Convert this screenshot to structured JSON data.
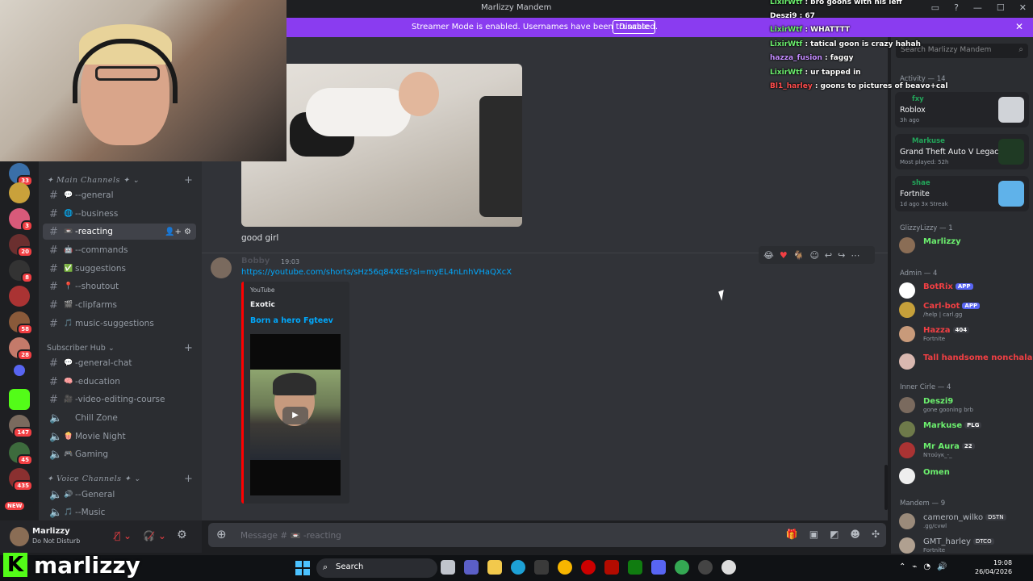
{
  "window": {
    "title": "Marlizzy Mandem"
  },
  "banner": {
    "text": "Streamer Mode is enabled. Usernames have been truncated.",
    "button": "Disable"
  },
  "rail": {
    "badges": [
      "33",
      "3",
      "20",
      "8",
      "58",
      "28",
      "147",
      "45",
      "435",
      "NEW"
    ]
  },
  "sidebar": {
    "main_category": "✦ Main Channels ✦",
    "subscriber_category": "Subscriber Hub",
    "voice_category": "✦ Voice Channels ✦",
    "channels": [
      {
        "label": "--general",
        "emoji": "💬"
      },
      {
        "label": "--business",
        "emoji": "🌐"
      },
      {
        "label": "-reacting",
        "emoji": "📼",
        "active": true
      },
      {
        "label": "--commands",
        "emoji": "🤖"
      },
      {
        "label": "suggestions",
        "emoji": "✅"
      },
      {
        "label": "--shoutout",
        "emoji": "📍"
      },
      {
        "label": "-clipfarms",
        "emoji": "🎬"
      },
      {
        "label": "music-suggestions",
        "emoji": "🎵"
      }
    ],
    "sub_channels": [
      {
        "label": "-general-chat",
        "emoji": "💬"
      },
      {
        "label": "-education",
        "emoji": "🧠"
      },
      {
        "label": "-video-editing-course",
        "emoji": "🎥"
      },
      {
        "label": "Chill Zone",
        "emoji": ""
      },
      {
        "label": "Movie Night",
        "emoji": "🍿"
      },
      {
        "label": "Gaming",
        "emoji": "🎮"
      }
    ],
    "voice_channels": [
      {
        "label": "--General",
        "emoji": "🔊"
      },
      {
        "label": "--Music",
        "emoji": "🎵"
      }
    ]
  },
  "user": {
    "name": "Marlizzy",
    "status": "Do Not Disturb"
  },
  "chat": {
    "message1_text": "good girl",
    "message2": {
      "author": "Bobby",
      "time": "19:03",
      "link": "https://youtube.com/shorts/sHz56q84XEs?si=myEL4nLnhVHaQXcX",
      "embed_provider": "YouTube",
      "embed_author": "Exotic",
      "embed_title": "Born a hero Fgteev"
    },
    "composer_placeholder": "Message # 📼 -reacting"
  },
  "members": {
    "search_placeholder": "Search Marlizzy Mandem",
    "activity_header": "Activity — 14",
    "activities": [
      {
        "user": "fxy",
        "game": "Roblox",
        "sub": "3h ago",
        "color": "#6d7883"
      },
      {
        "user": "Markuse",
        "game": "Grand Theft Auto V Legacy",
        "sub": "Most played: 52h",
        "color": "#1f3a24"
      },
      {
        "user": "shae",
        "game": "Fortnite",
        "sub": "1d ago  3x Streak",
        "color": "#5fb2ea"
      }
    ],
    "groups": [
      {
        "header": "GlizzyLizzy — 1",
        "members": [
          {
            "name": "Marlizzy",
            "color": "#6cf06e",
            "status": ""
          }
        ]
      },
      {
        "header": "Admin — 4",
        "members": [
          {
            "name": "BotRix",
            "color": "#f23f43",
            "status": "",
            "tag": "APP"
          },
          {
            "name": "Carl-bot",
            "color": "#f23f43",
            "status": "/help | carl.gg",
            "tag": "APP"
          },
          {
            "name": "Hazza",
            "color": "#f23f43",
            "status": "Fortnite",
            "tag": "404"
          },
          {
            "name": "Tall handsome nonchalan...",
            "color": "#f23f43",
            "status": ""
          }
        ]
      },
      {
        "header": "Inner Cirle — 4",
        "members": [
          {
            "name": "Deszi9",
            "color": "#6cf06e",
            "status": "gone gooning brb"
          },
          {
            "name": "Markuse",
            "color": "#6cf06e",
            "status": "",
            "tag": "PLG"
          },
          {
            "name": "Mr Aura",
            "color": "#6cf06e",
            "status": "Ντούγκ_-_",
            "tag": "22"
          },
          {
            "name": "Omen",
            "color": "#6cf06e",
            "status": ""
          }
        ]
      },
      {
        "header": "Mandem — 9",
        "members": [
          {
            "name": "cameron_wilko",
            "color": "#b5bac1",
            "status": ".gg/cvwl",
            "tag": "DSTN"
          },
          {
            "name": "GMT_harley",
            "color": "#b5bac1",
            "status": "Fortnite",
            "tag": "DTCO"
          }
        ]
      }
    ]
  },
  "twitch_chat": [
    {
      "user": "LixirWtf",
      "msg": ": bro goons with his leff",
      "color": "#6cf06e"
    },
    {
      "user": "Deszi9",
      "msg": ": 67",
      "color": "#ffffff"
    },
    {
      "user": "LixirWtf",
      "msg": ": WHATTTT",
      "color": "#6cf06e"
    },
    {
      "user": "LixirWtf",
      "msg": ": tatical goon is crazy hahah",
      "color": "#6cf06e"
    },
    {
      "user": "hazza_fusion",
      "msg": ": faggy",
      "color": "#c48cff"
    },
    {
      "user": "LixirWtf",
      "msg": ": ur tapped in",
      "color": "#6cf06e"
    },
    {
      "user": "Bl1_harley",
      "msg": ": goons to pictures of beavo+cal",
      "color": "#ff4d4d"
    }
  ],
  "brand": {
    "letter": "K",
    "word": "marlizzy"
  },
  "taskbar": {
    "search": "Search",
    "time": "19:08",
    "date": "26/04/2026"
  }
}
